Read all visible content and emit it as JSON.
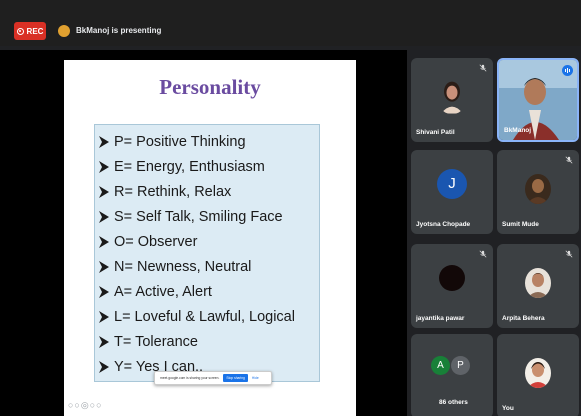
{
  "topbar": {
    "rec_label": "REC",
    "presenting_text": "BkManoj is presenting"
  },
  "slide": {
    "title": "Personality",
    "bullets": [
      "P= Positive Thinking",
      "E= Energy, Enthusiasm",
      "R= Rethink, Relax",
      "S=  Self Talk, Smiling Face",
      "O= Observer",
      "N= Newness, Neutral",
      "A= Active, Alert",
      "L= Loveful & Lawful, Logical",
      "T= Tolerance",
      "Y= Yes I can.."
    ],
    "share_bar": {
      "message": "meet.google.com is sharing your screen.",
      "stop_label": "Stop sharing",
      "hide_label": "Hide"
    }
  },
  "participants": [
    {
      "name": "Shivani Patil",
      "muted": true
    },
    {
      "name": "BkManoj",
      "speaking": true
    },
    {
      "name": "Jyotsna Chopade",
      "initial": "J",
      "muted": false
    },
    {
      "name": "Sumit Mude",
      "muted": true
    },
    {
      "name": "jayantika pawar",
      "muted": true
    },
    {
      "name": "Arpita Behera",
      "muted": true
    },
    {
      "name": "86 others",
      "initials": [
        "A",
        "P"
      ]
    },
    {
      "name": "You"
    }
  ],
  "colors": {
    "rec": "#d93025",
    "title": "#6a4ba0",
    "tile_bg": "#3c4043",
    "active_border": "#8ab4f8",
    "avatar_j": "#1a56b0",
    "avatar_a": "#188038",
    "avatar_p": "#5f6368"
  }
}
